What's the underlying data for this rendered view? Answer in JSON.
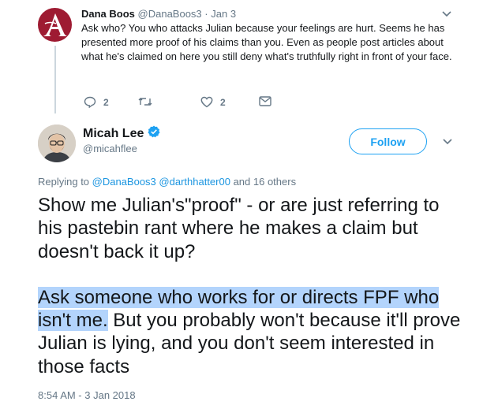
{
  "reply_tweet": {
    "author_name": "Dana Boos",
    "handle": "@DanaBoos3",
    "separator": "·",
    "date": "Jan 3",
    "text": "Ask who? You who attacks Julian because your feelings are hurt. Seems he has presented more proof of his claims than you. Even as people post articles about what he's claimed on here you still deny what's truthfully right in front of your face.",
    "reply_count": "2",
    "retweet_count": "",
    "like_count": "2",
    "avatar_icon": "alabama-a-logo",
    "avatar_color": "#9e1b32"
  },
  "main_tweet": {
    "author_name": "Micah Lee",
    "handle": "@micahflee",
    "verified": true,
    "follow_label": "Follow",
    "replying_prefix": "Replying to ",
    "replying_mention_1": "@DanaBoos3",
    "replying_mention_2": "@darthhatter00",
    "replying_suffix": " and 16 others",
    "paragraph_1": "Show me Julian's\"proof\" - or are just referring to his pastebin rant where he makes a claim but doesn't back it up?",
    "paragraph_2_highlighted": "Ask someone who works for or directs FPF who isn't me.",
    "paragraph_2_rest": " But you probably won't because it'll prove Julian is lying, and you don't seem interested in those facts",
    "timestamp": "8:54 AM - 3 Jan 2018"
  },
  "colors": {
    "link": "#1b95e0",
    "follow_border": "#1da1f2",
    "muted_text": "#657786",
    "selection_highlight": "#b3d4fc",
    "verified_badge": "#1da1f2"
  }
}
